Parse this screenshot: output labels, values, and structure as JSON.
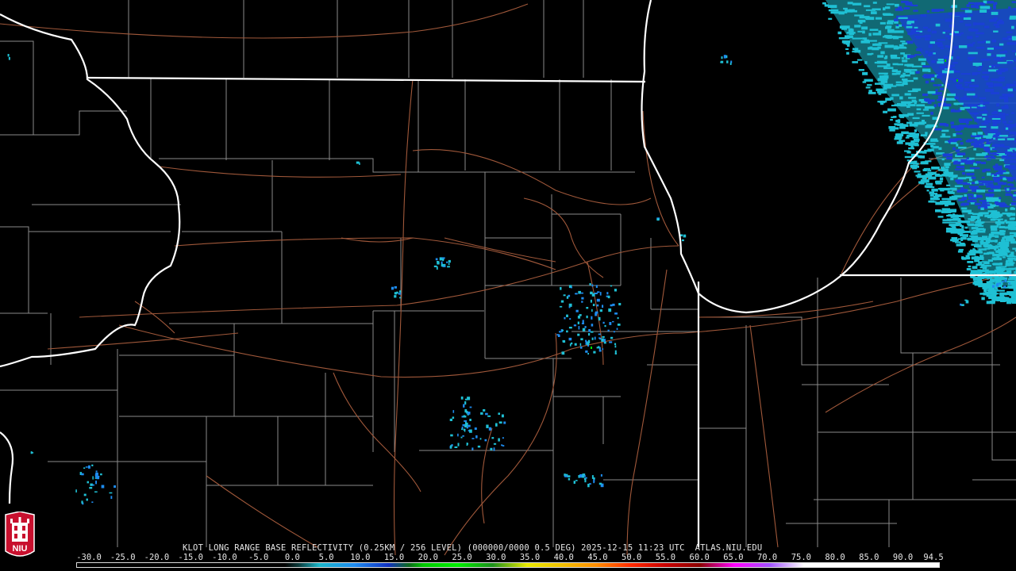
{
  "title_line": "KLOT LONG RANGE BASE REFLECTIVITY (0.25KM / 256 LEVEL) (000000/0000 0.5 DEG) 2025-12-15 11:23 UTC  ATLAS.NIU.EDU",
  "logo": {
    "text": "NIU",
    "name": "niu-logo"
  },
  "colorbar": {
    "ticks": [
      "-30.0",
      "-25.0",
      "-20.0",
      "-15.0",
      "-10.0",
      "-5.0",
      "0.0",
      "5.0",
      "10.0",
      "15.0",
      "20.0",
      "25.0",
      "30.0",
      "35.0",
      "40.0",
      "45.0",
      "50.0",
      "55.0",
      "60.0",
      "65.0",
      "70.0",
      "75.0",
      "80.0",
      "85.0",
      "90.0",
      "94.5"
    ],
    "stops": [
      {
        "v": -30,
        "c": "#000000"
      },
      {
        "v": 0,
        "c": "#000000"
      },
      {
        "v": 2,
        "c": "#0a3a3a"
      },
      {
        "v": 5,
        "c": "#1ab6c9"
      },
      {
        "v": 10,
        "c": "#1e8cf0"
      },
      {
        "v": 15,
        "c": "#1030c0"
      },
      {
        "v": 18,
        "c": "#0b6b1a"
      },
      {
        "v": 20,
        "c": "#00c800"
      },
      {
        "v": 25,
        "c": "#00ee00"
      },
      {
        "v": 30,
        "c": "#1b8f1b"
      },
      {
        "v": 35,
        "c": "#e8e800"
      },
      {
        "v": 40,
        "c": "#f0c000"
      },
      {
        "v": 45,
        "c": "#ff8c00"
      },
      {
        "v": 50,
        "c": "#ff2a00"
      },
      {
        "v": 55,
        "c": "#c80000"
      },
      {
        "v": 60,
        "c": "#8a0000"
      },
      {
        "v": 65,
        "c": "#ff00ff"
      },
      {
        "v": 70,
        "c": "#a050ff"
      },
      {
        "v": 75,
        "c": "#ffffff"
      },
      {
        "v": 94.5,
        "c": "#ffffff"
      }
    ]
  },
  "colors": {
    "state_border": "#ffffff",
    "county_border": "#8a8a8a",
    "highway": "#a0583a",
    "lake_echo_light": "#1fc0d4",
    "lake_echo_deep": "#1a3fd6"
  }
}
